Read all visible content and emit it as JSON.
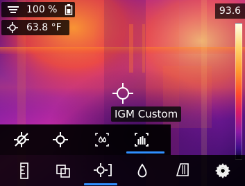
{
  "status": {
    "zoom_text": "100 %",
    "spot_temp_text": "63.8 °F"
  },
  "right_readout": {
    "value": "93.6"
  },
  "measurement": {
    "label": "IGM Custom"
  },
  "menu": {
    "top_items": [
      {
        "icon": "spot-off-icon"
      },
      {
        "icon": "center-spot-icon"
      },
      {
        "icon": "dew-point-icon"
      },
      {
        "icon": "igm-custom-icon",
        "selected": true
      }
    ],
    "bottom_items": [
      {
        "icon": "scale-icon"
      },
      {
        "icon": "image-blend-icon"
      },
      {
        "icon": "measurement-mode-icon",
        "selected": true
      },
      {
        "icon": "humidity-icon"
      },
      {
        "icon": "emissivity-icon"
      },
      {
        "icon": "settings-gear-icon"
      }
    ]
  },
  "colors": {
    "accent": "#2f8fff"
  }
}
